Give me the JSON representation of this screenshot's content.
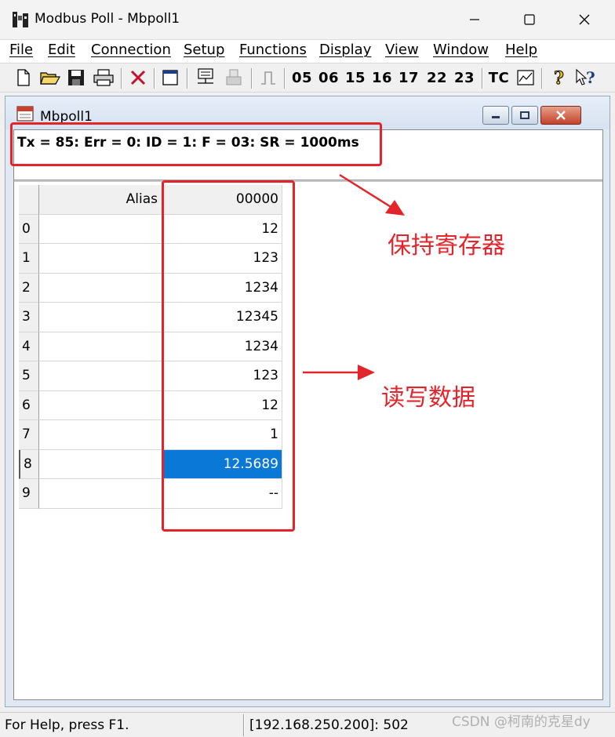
{
  "window": {
    "title": "Modbus Poll - Mbpoll1",
    "icon": "modbus-poll-icon",
    "controls": [
      "minimize-icon",
      "maximize-icon",
      "close-icon"
    ]
  },
  "menu": [
    {
      "label": "File"
    },
    {
      "label": "Edit"
    },
    {
      "label": "Connection"
    },
    {
      "label": "Setup"
    },
    {
      "label": "Functions"
    },
    {
      "label": "Display"
    },
    {
      "label": "View"
    },
    {
      "label": "Window"
    },
    {
      "label": "Help"
    }
  ],
  "toolbar": {
    "icons": [
      "new-icon",
      "open-icon",
      "save-icon",
      "print-icon",
      "disconnect-icon",
      "window-icon",
      "connect-icon",
      "read-icon",
      "pulse-icon",
      "help-icon",
      "whats-this-icon"
    ],
    "function_codes": [
      "05",
      "06",
      "15",
      "16",
      "17",
      "22",
      "23"
    ],
    "tc_label": "TC"
  },
  "child": {
    "title": "Mbpoll1",
    "status_line": "Tx = 85: Err = 0: ID = 1: F = 03: SR = 1000ms"
  },
  "grid": {
    "header": {
      "alias": "Alias",
      "address": "00000"
    },
    "rows": [
      {
        "index": "0",
        "alias": "",
        "value": "12"
      },
      {
        "index": "1",
        "alias": "",
        "value": "123"
      },
      {
        "index": "2",
        "alias": "",
        "value": "1234"
      },
      {
        "index": "3",
        "alias": "",
        "value": "12345"
      },
      {
        "index": "4",
        "alias": "",
        "value": "1234"
      },
      {
        "index": "5",
        "alias": "",
        "value": "123"
      },
      {
        "index": "6",
        "alias": "",
        "value": "12"
      },
      {
        "index": "7",
        "alias": "",
        "value": "1"
      },
      {
        "index": "8",
        "alias": "",
        "value": "12.5689",
        "selected": true
      },
      {
        "index": "9",
        "alias": "",
        "value": "--"
      }
    ]
  },
  "annotations": {
    "holding_registers": "保持寄存器",
    "read_write_data": "读写数据",
    "color": "#e3242b"
  },
  "statusbar": {
    "help": "For Help, press F1.",
    "connection": "[192.168.250.200]: 502"
  },
  "watermark": "CSDN @柯南的克星dy",
  "colors": {
    "selection": "#0a78d7",
    "annotation": "#e3242b"
  }
}
